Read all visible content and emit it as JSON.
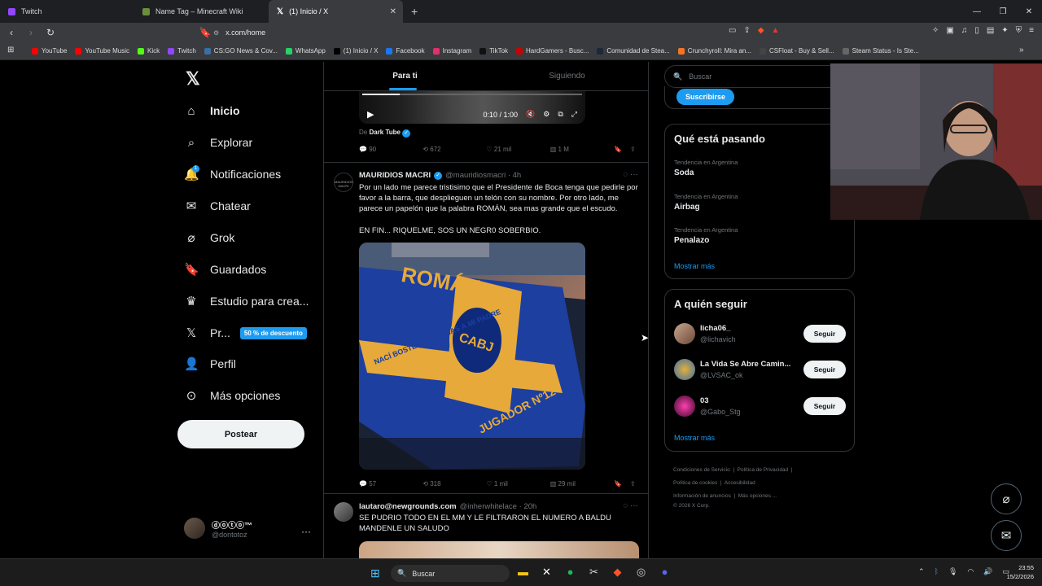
{
  "browser": {
    "tabs": [
      {
        "title": "Twitch",
        "color": "#9146ff"
      },
      {
        "title": "Name Tag – Minecraft Wiki",
        "color": "#6a8f3c"
      },
      {
        "title": "(1) Inicio / X",
        "color": "#000000"
      }
    ],
    "url": "x.com/home",
    "bookmarks": [
      {
        "label": "YouTube",
        "color": "#ff0000"
      },
      {
        "label": "YouTube Music",
        "color": "#ff0000"
      },
      {
        "label": "Kick",
        "color": "#53fc18"
      },
      {
        "label": "Twitch",
        "color": "#9146ff"
      },
      {
        "label": "CS:GO News & Cov...",
        "color": "#3a6ea5"
      },
      {
        "label": "WhatsApp",
        "color": "#25d366"
      },
      {
        "label": "(1) Inicio / X",
        "color": "#000000"
      },
      {
        "label": "Facebook",
        "color": "#1877f2"
      },
      {
        "label": "Instagram",
        "color": "#e1306c"
      },
      {
        "label": "TikTok",
        "color": "#111111"
      },
      {
        "label": "HardGamers - Busc...",
        "color": "#cc0000"
      },
      {
        "label": "Comunidad de Stea...",
        "color": "#1b2838"
      },
      {
        "label": "Crunchyroll: Mira an...",
        "color": "#f47521"
      },
      {
        "label": "CSFloat - Buy & Sell...",
        "color": "#444444"
      },
      {
        "label": "Steam Status - Is Ste...",
        "color": "#666666"
      }
    ]
  },
  "nav": {
    "items": [
      {
        "label": "Inicio",
        "icon": "home-icon"
      },
      {
        "label": "Explorar",
        "icon": "search-icon"
      },
      {
        "label": "Notificaciones",
        "icon": "bell-icon",
        "badge": "1"
      },
      {
        "label": "Chatear",
        "icon": "mail-icon"
      },
      {
        "label": "Grok",
        "icon": "grok-icon"
      },
      {
        "label": "Guardados",
        "icon": "bookmark-icon"
      },
      {
        "label": "Estudio para crea...",
        "icon": "studio-icon"
      },
      {
        "label": "Pr...",
        "icon": "x-premium-icon",
        "discount": "50 % de descuento"
      },
      {
        "label": "Perfil",
        "icon": "person-icon"
      },
      {
        "label": "Más opciones",
        "icon": "more-circle-icon"
      }
    ],
    "post_button": "Postear",
    "account": {
      "name": "ⓓⓞⓣⓞ™",
      "handle": "@dontotoz",
      "more": "···"
    }
  },
  "timeline": {
    "tabs": [
      "Para ti",
      "Siguiendo"
    ],
    "video": {
      "time": "0:10 / 1:00",
      "progress": 0.17
    },
    "from_label": "De",
    "from_source": "Dark Tube",
    "post1_stats": [
      "90",
      "672",
      "21 mil",
      "1 M"
    ],
    "post2": {
      "avatar_label": "MAURIDIOS MACRI",
      "name": "MAURIDIOS MACRI",
      "handle": "@mauridiosmacri · 4h",
      "text1": "Por un lado me parece tristisimo que el Presidente de Boca tenga que pedirle por favor a la barra, que desplieguen un telón con su nombre. Por otro lado, me parece un papelón que la palabra ROMÁN, sea mas grande que el escudo.",
      "text2": "EN FIN... RIQUELME, SOS UN NEGR0 SOBERBIO.",
      "banner_top": "ROMÁN",
      "banner_left": "NACÍ BOSTERO GRACIAS A MI PADRE",
      "banner_right": "JUGADOR Nº12",
      "crest": "CABJ",
      "stats": [
        "57",
        "318",
        "1 mil",
        "29 mil"
      ]
    },
    "post3": {
      "name": "lautaro@newgrounds.com",
      "handle": "@inherwhitelace · 20h",
      "text": "SE PUDRIO TODO EN EL MM Y LE FILTRARON EL NUMERO A BALDU MANDENLE UN SALUDO"
    }
  },
  "right": {
    "search_placeholder": "Buscar",
    "subscribe": "Suscribirse",
    "trends_title": "Qué está pasando",
    "trends": [
      {
        "context": "Tendencia en Argentina",
        "name": "Soda"
      },
      {
        "context": "Tendencia en Argentina",
        "name": "Airbag"
      },
      {
        "context": "Tendencia en Argentina",
        "name": "Penalazo"
      }
    ],
    "show_more": "Mostrar más",
    "follow_title": "A quién seguir",
    "follow": [
      {
        "name": "licha06_",
        "handle": "@lichavich",
        "btn": "Seguir"
      },
      {
        "name": "La Vida Se Abre Camin...",
        "handle": "@LVSAC_ok",
        "btn": "Seguir"
      },
      {
        "name": "03",
        "handle": "@Gabo_Stg",
        "btn": "Seguir"
      }
    ],
    "footer": [
      "Condiciones de Servicio",
      "Política de Privacidad",
      "Política de cookies",
      "Accesibilidad",
      "Información de anuncios",
      "Más opciones ...",
      "© 2026 X Corp."
    ]
  },
  "taskbar": {
    "search": "Buscar",
    "time": "23:55",
    "date": "15/2/2026"
  }
}
